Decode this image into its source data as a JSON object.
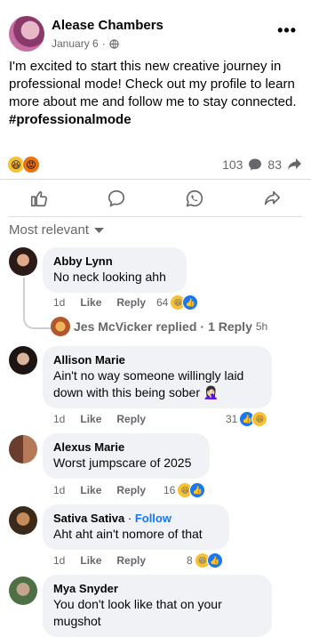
{
  "post": {
    "author": "Alease Chambers",
    "date": "January 6",
    "date_sep": "·",
    "text": "I'm excited to start this new creative journey in professional mode! Check out my profile to learn more about me and follow me to stay connected.",
    "hashtag": "#professionalmode",
    "comment_count": "103",
    "share_count": "83"
  },
  "sort": {
    "label": "Most relevant"
  },
  "comments": [
    {
      "name": "Abby Lynn",
      "text": "No neck looking ahh",
      "time": "1d",
      "like": "Like",
      "reply": "Reply",
      "reactions": "64"
    },
    {
      "name": "Allison Marie",
      "text": "Ain't no way someone willingly laid down with this being sober 🤦🏻‍♀️",
      "time": "1d",
      "like": "Like",
      "reply": "Reply",
      "reactions": "31"
    },
    {
      "name": "Alexus Marie",
      "text": "Worst jumpscare of 2025",
      "time": "1d",
      "like": "Like",
      "reply": "Reply",
      "reactions": "16"
    },
    {
      "name": "Sativa Sativa",
      "follow_sep": "·",
      "follow": "Follow",
      "text": "Aht aht ain't nomore of that",
      "time": "1d",
      "like": "Like",
      "reply": "Reply",
      "reactions": "8"
    },
    {
      "name": "Mya Snyder",
      "text": "You don't look like that on your mugshot"
    }
  ],
  "reply_summary": {
    "name": "Jes McVicker",
    "action": "replied",
    "sep": "·",
    "count": "1 Reply",
    "time": "5h"
  },
  "colors": {
    "accent": "#1877f2",
    "secondary_text": "#65676b",
    "bubble": "#f0f2f5"
  }
}
